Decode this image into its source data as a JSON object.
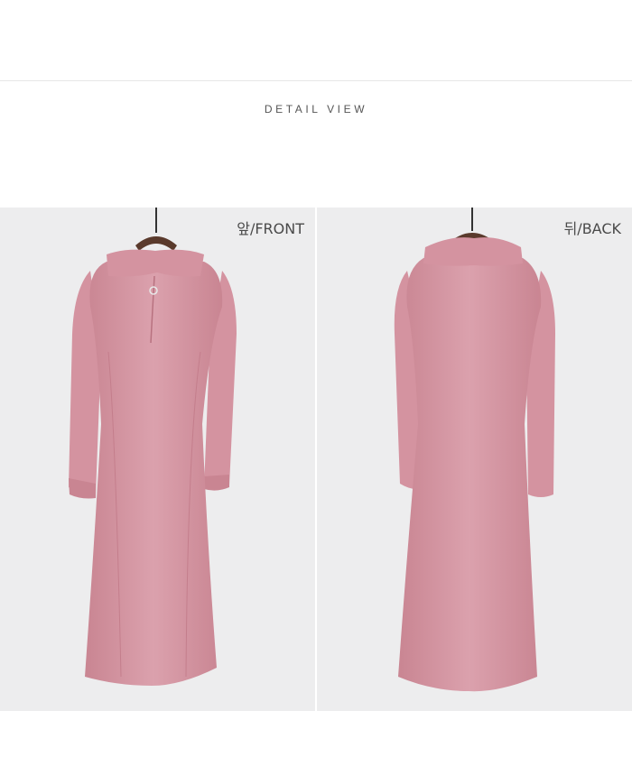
{
  "section": {
    "title": "DETAIL VIEW"
  },
  "photos": [
    {
      "label": "앞/FRONT"
    },
    {
      "label": "뒤/BACK"
    }
  ],
  "colors": {
    "dress": "#d89aa6",
    "dress_shade": "#c6808e",
    "background": "#ededee",
    "hanger": "#5a3a2c"
  }
}
